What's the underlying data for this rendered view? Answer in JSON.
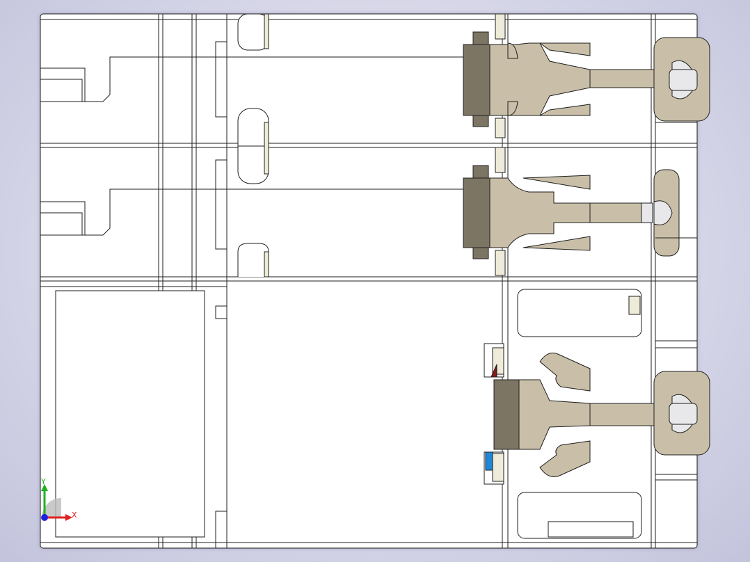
{
  "viewport": {
    "background_colors": [
      "#f2f2f7",
      "#c3c3dc"
    ]
  },
  "model": {
    "edge_color": "#1e1e1e",
    "face_color": "#ffffff",
    "tan_color": "#c9bfa8",
    "dark_color": "#7d7563",
    "cream_color": "#eeebd8",
    "red_accent": "#8b1a1a",
    "blue_accent": "#1e88d8"
  },
  "triad": {
    "x_label": "X",
    "y_label": "Y",
    "x_color": "#e02020",
    "y_color": "#20b020",
    "z_color": "#2020e0"
  }
}
